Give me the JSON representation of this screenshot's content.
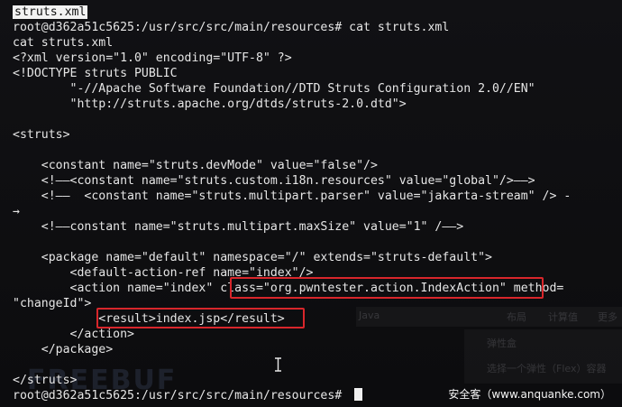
{
  "terminal": {
    "lines": [
      "struts.xml",
      "root@d362a51c5625:/usr/src/src/main/resources# cat struts.xml",
      "cat struts.xml",
      "<?xml version=\"1.0\" encoding=\"UTF-8\" ?>",
      "<!DOCTYPE struts PUBLIC",
      "        \"-//Apache Software Foundation//DTD Struts Configuration 2.0//EN\"",
      "        \"http://struts.apache.org/dtds/struts-2.0.dtd\">",
      "",
      "<struts>",
      "",
      "    <constant name=\"struts.devMode\" value=\"false\"/>",
      "    <!——<constant name=\"struts.custom.i18n.resources\" value=\"global\"/>——>",
      "    <!——  <constant name=\"struts.multipart.parser\" value=\"jakarta-stream\" /> -",
      "→",
      "    <!——constant name=\"struts.multipart.maxSize\" value=\"1\" /——>",
      "",
      "    <package name=\"default\" namespace=\"/\" extends=\"struts-default\">",
      "        <default-action-ref name=\"index\"/>",
      "        <action name=\"index\" class=\"org.pwntester.action.IndexAction\" method=",
      "\"changeId\">",
      "            <result>index.jsp</result>",
      "        </action>",
      "    </package>",
      "",
      "</struts>",
      "root@d362a51c5625:/usr/src/src/main/resources# "
    ]
  },
  "watermark": "安全客（www.anquanke.com）",
  "ghost": {
    "tab1": "Java",
    "tab2": "布局",
    "tab3": "计算值",
    "tab4": "更多",
    "section": "弹性盒",
    "hint": "选择一个弹性（Flex）容器",
    "logo": "FREEBUF"
  },
  "colors": {
    "background": "#0d0d0f",
    "text": "#e6e6e6",
    "highlight_box": "#d8262b"
  },
  "icons": {
    "cursor": "text-cursor-icon"
  }
}
